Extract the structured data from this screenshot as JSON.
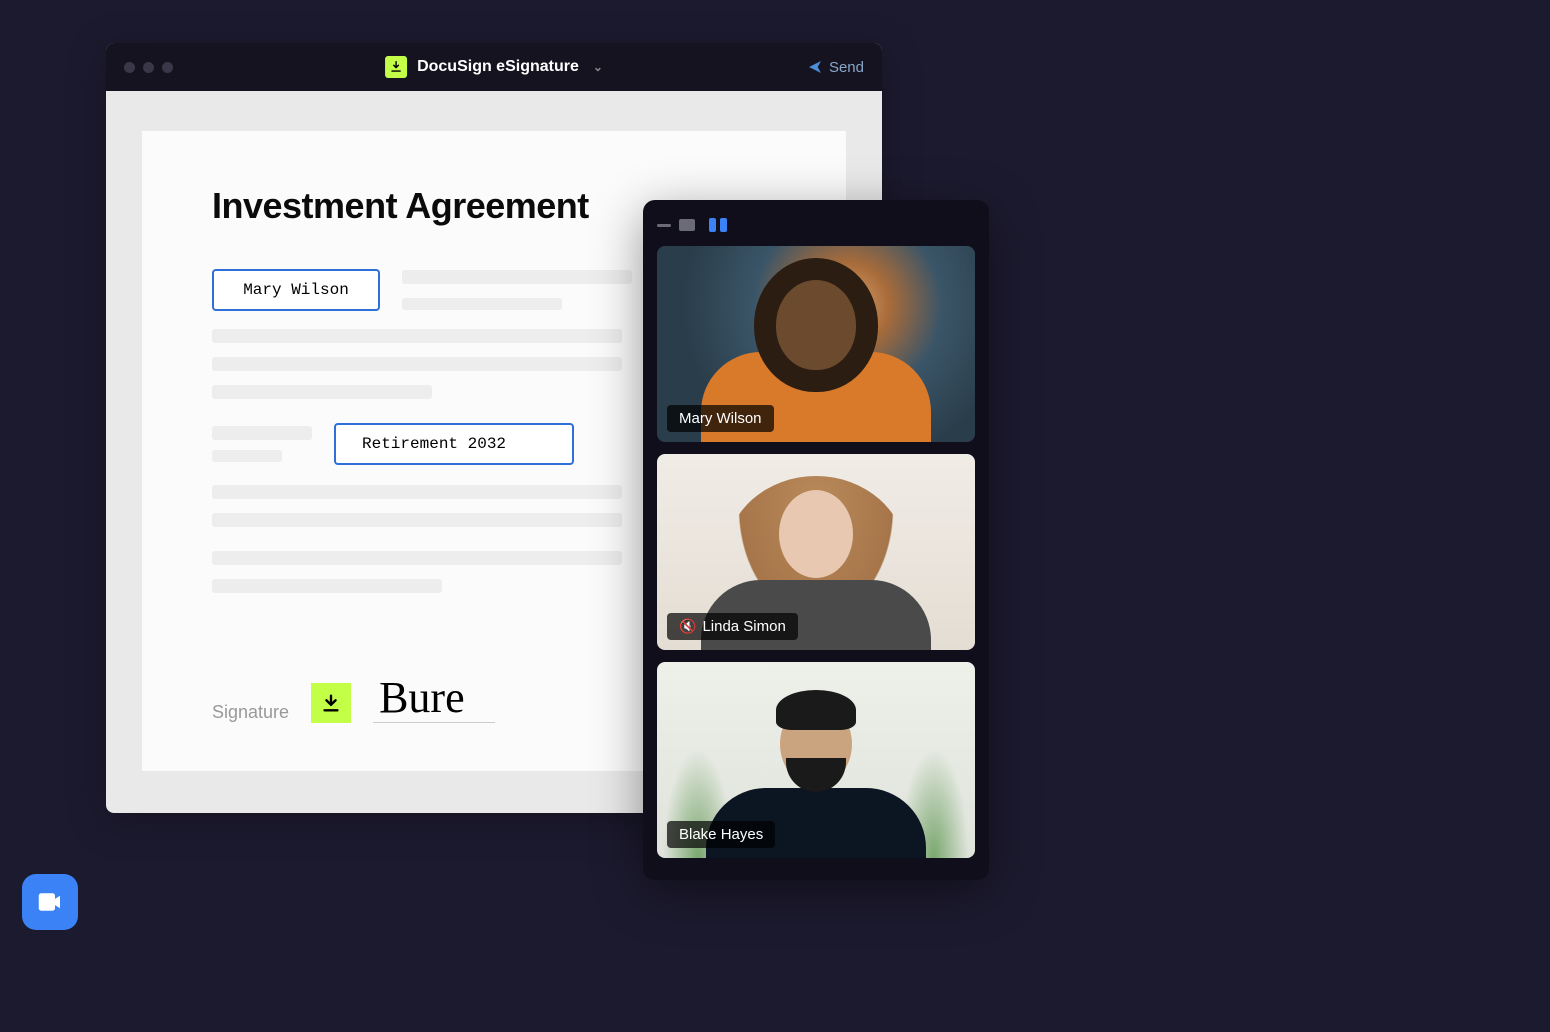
{
  "docWindow": {
    "appName": "DocuSign eSignature",
    "sendLabel": "Send",
    "iconName": "docusign-download-icon"
  },
  "document": {
    "title": "Investment Agreement",
    "field_name": "Mary Wilson",
    "field_plan": "Retirement 2032",
    "signatureLabel": "Signature",
    "signatureScript": "Bure"
  },
  "videoCall": {
    "participants": [
      {
        "name": "Mary Wilson",
        "muted": false
      },
      {
        "name": "Linda Simon",
        "muted": true
      },
      {
        "name": "Blake Hayes",
        "muted": false
      }
    ]
  },
  "fab": {
    "name": "zoom-video-icon"
  }
}
